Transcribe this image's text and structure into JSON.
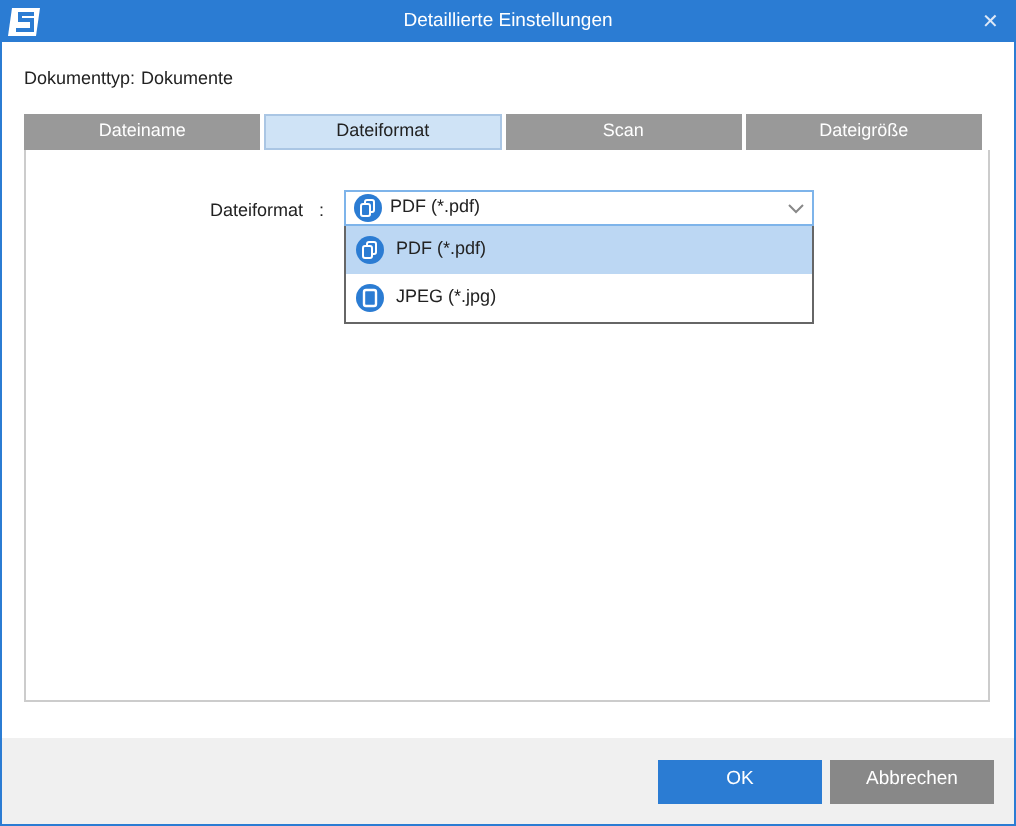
{
  "window": {
    "title": "Detaillierte Einstellungen",
    "close": "✕"
  },
  "document_type": {
    "label": "Dokumenttyp:",
    "value": "Dokumente"
  },
  "tabs": [
    {
      "label": "Dateiname",
      "selected": false
    },
    {
      "label": "Dateiformat",
      "selected": true
    },
    {
      "label": "Scan",
      "selected": false
    },
    {
      "label": "Dateigröße",
      "selected": false
    }
  ],
  "file_format": {
    "label": "Dateiformat",
    "separator": ":",
    "value": "PDF (*.pdf)",
    "expanded": true,
    "options": [
      {
        "label": "PDF (*.pdf)",
        "kind": "pdf",
        "selected": true
      },
      {
        "label": "JPEG (*.jpg)",
        "kind": "jpeg",
        "selected": false
      }
    ]
  },
  "buttons": [
    {
      "label": "OK",
      "kind": "primary"
    },
    {
      "label": "Abbrechen",
      "kind": "secondary"
    }
  ]
}
